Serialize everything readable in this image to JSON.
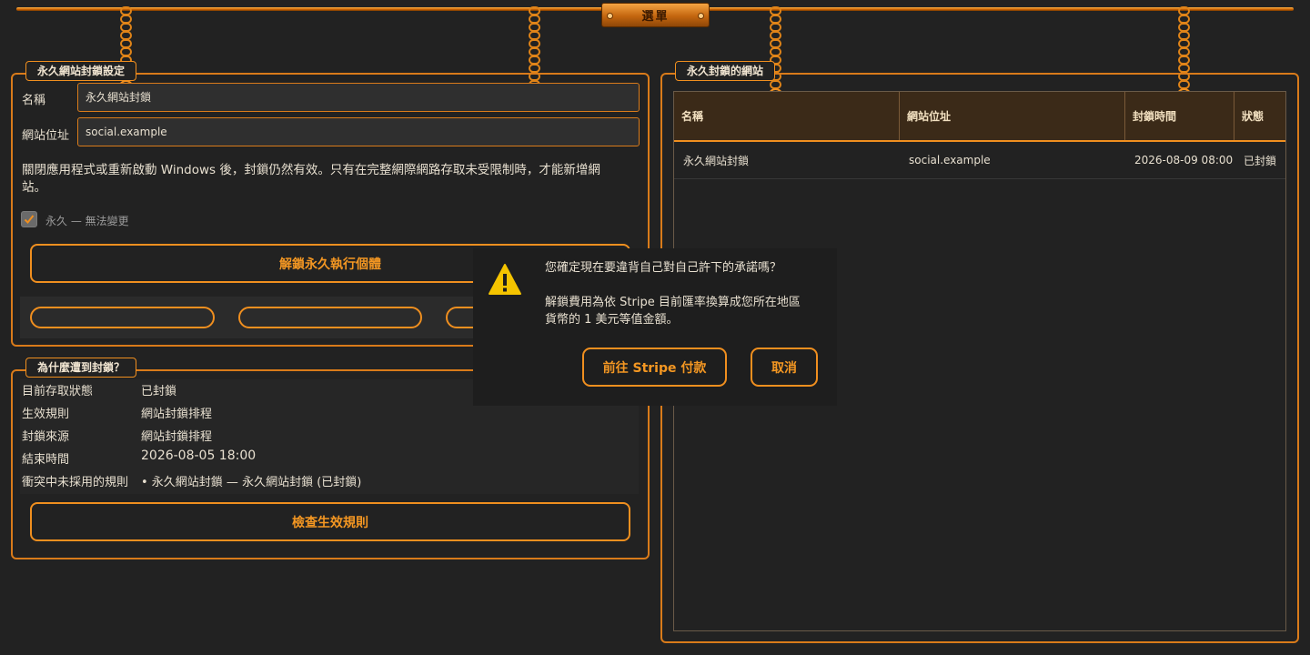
{
  "top_menu": {
    "label": "選單"
  },
  "left_group": {
    "title": "永久網站封鎖設定",
    "name_label": "名稱",
    "name_value": "永久網站封鎖",
    "url_label": "網站位址",
    "url_value": "social.example",
    "info_line1": "關閉應用程式或重新啟動 Windows 後，封鎖仍然有效。只有在完整網際網路存取未受限制時，才能新增網",
    "info_line2": "站。",
    "permanent_checkbox_label": "永久 — 無法變更",
    "permanent_checked": true,
    "unlock_button": "解鎖永久執行個體"
  },
  "why_group": {
    "title": "為什麼遭到封鎖？",
    "rows": [
      {
        "key": "目前存取狀態",
        "value": "已封鎖"
      },
      {
        "key": "生效規則",
        "value": "網站封鎖排程"
      },
      {
        "key": "封鎖來源",
        "value": "網站封鎖排程"
      },
      {
        "key": "結束時間",
        "value": "2026-08-05 18:00"
      },
      {
        "key": "衝突中未採用的規則",
        "value": "• 永久網站封鎖 — 永久網站封鎖 (已封鎖)"
      }
    ],
    "check_button": "檢查生效規則"
  },
  "right_group": {
    "title": "永久封鎖的網站",
    "columns": [
      "名稱",
      "網站位址",
      "封鎖時間",
      "狀態"
    ],
    "rows": [
      [
        "永久網站封鎖",
        "social.example",
        "2026-08-09 08:00",
        "已封鎖"
      ]
    ]
  },
  "dialog": {
    "question": "您確定現在要違背自己對自己許下的承諾嗎？",
    "detail_line1": "解鎖費用為依 Stripe 目前匯率換算成您所在地區",
    "detail_line2": "貨幣的 1 美元等值金額。",
    "pay_button": "前往 Stripe 付款",
    "cancel_button": "取消",
    "icon": "warning-icon"
  },
  "colors": {
    "accent": "#f08f1f",
    "background": "#222222",
    "warning": "#f5c400"
  }
}
